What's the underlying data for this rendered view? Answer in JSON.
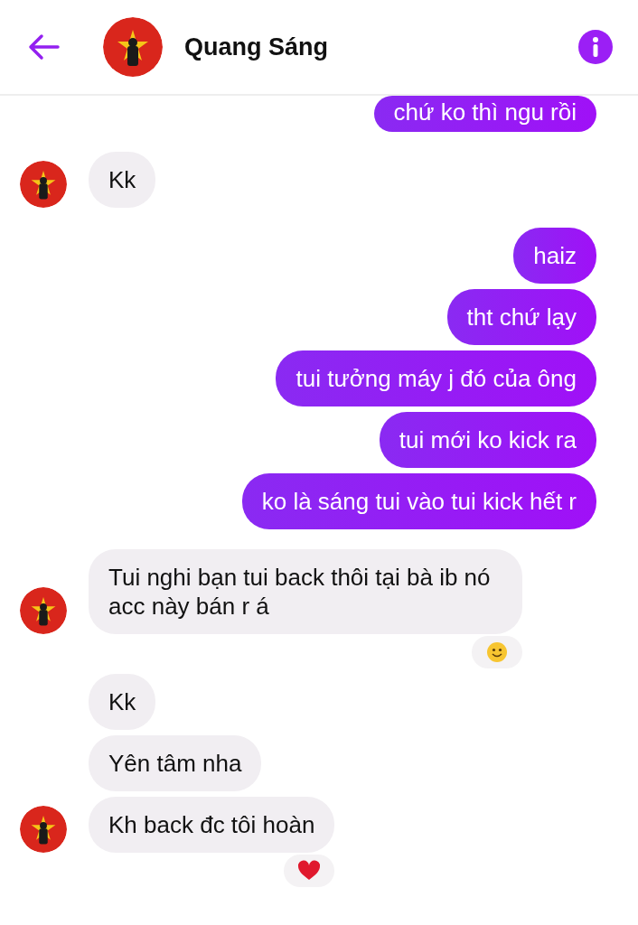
{
  "header": {
    "name": "Quang Sáng"
  },
  "messages": [
    {
      "kind": "sent",
      "text": "chứ ko thì ngu rồi"
    },
    {
      "kind": "received",
      "text": "Kk",
      "avatar": true
    },
    {
      "kind": "sent",
      "text": "haiz"
    },
    {
      "kind": "sent",
      "text": "tht chứ lạy"
    },
    {
      "kind": "sent",
      "text": "tui tưởng máy j đó của ông"
    },
    {
      "kind": "sent",
      "text": "tui mới ko kick ra"
    },
    {
      "kind": "sent",
      "text": "ko là sáng tui vào tui kick hết r"
    },
    {
      "kind": "received",
      "text": "Tui nghi bạn tui back thôi tại bà ib nó acc này bán r á",
      "avatar": true,
      "reaction": {
        "kind": "smile"
      }
    },
    {
      "kind": "received",
      "text": "Kk",
      "avatar": false
    },
    {
      "kind": "received",
      "text": "Yên tâm nha",
      "avatar": false
    },
    {
      "kind": "received",
      "text": "Kh back đc tôi hoàn",
      "avatar": true,
      "reaction": {
        "kind": "heart"
      }
    }
  ]
}
